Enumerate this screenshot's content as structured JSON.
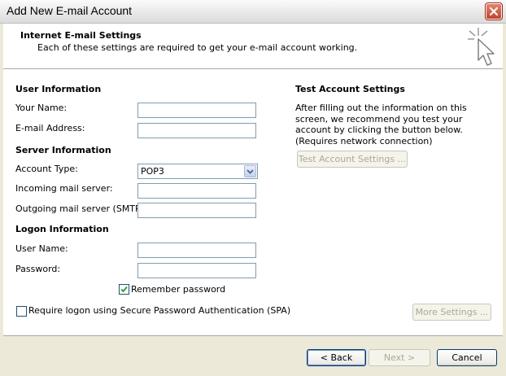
{
  "window": {
    "title": "Add New E-mail Account"
  },
  "header": {
    "title": "Internet E-mail Settings",
    "subtitle": "Each of these settings are required to get your e-mail account working."
  },
  "user_info": {
    "heading": "User Information",
    "your_name_label": "Your Name:",
    "your_name_value": "",
    "email_label": "E-mail Address:",
    "email_value": ""
  },
  "server_info": {
    "heading": "Server Information",
    "account_type_label": "Account Type:",
    "account_type_value": "POP3",
    "incoming_label": "Incoming mail server:",
    "incoming_value": "",
    "outgoing_label": "Outgoing mail server (SMTP):",
    "outgoing_value": ""
  },
  "logon_info": {
    "heading": "Logon Information",
    "username_label": "User Name:",
    "username_value": "",
    "password_label": "Password:",
    "password_value": "",
    "remember_label": "Remember password",
    "remember_checked": true,
    "spa_label": "Require logon using Secure Password Authentication (SPA)",
    "spa_checked": false
  },
  "test_settings": {
    "heading": "Test Account Settings",
    "description": "After filling out the information on this screen, we recommend you test your account by clicking the button below. (Requires network connection)",
    "test_button": "Test Account Settings ..."
  },
  "more_settings_button": "More Settings ...",
  "footer": {
    "back": "< Back",
    "next": "Next >",
    "cancel": "Cancel"
  },
  "icons": {
    "close": "close-icon",
    "wizard": "cursor-sparkle-icon",
    "dropdown": "chevron-down-icon",
    "check": "check-icon"
  }
}
